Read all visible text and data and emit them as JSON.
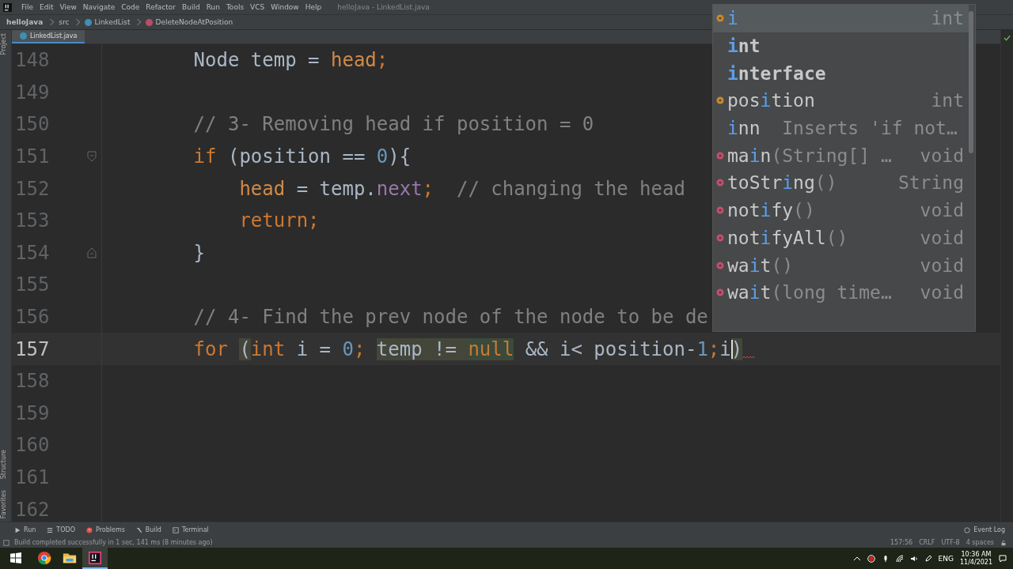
{
  "window": {
    "title": "helloJava - LinkedList.java"
  },
  "menu": [
    "File",
    "Edit",
    "View",
    "Navigate",
    "Code",
    "Refactor",
    "Build",
    "Run",
    "Tools",
    "VCS",
    "Window",
    "Help"
  ],
  "breadcrumbs": [
    {
      "label": "helloJava",
      "kind": "project"
    },
    {
      "label": "src",
      "kind": "folder"
    },
    {
      "label": "LinkedList",
      "kind": "class"
    },
    {
      "label": "DeleteNodeAtPosition",
      "kind": "method"
    }
  ],
  "left_tools": [
    {
      "label": "Project",
      "kind": "top"
    },
    {
      "label": "Structure",
      "kind": "bottom"
    },
    {
      "label": "Favorites",
      "kind": "bottom"
    }
  ],
  "tabs": [
    {
      "label": "LinkedList.java",
      "selected": true
    }
  ],
  "editor": {
    "lines": [
      {
        "number": "148",
        "current": false,
        "fold_start": false,
        "fold_end": false,
        "tokens": [
          {
            "text": "        Node temp = ",
            "kind": "plain",
            "marked": false
          },
          {
            "text": "head",
            "kind": "static",
            "marked": false
          },
          {
            "text": ";",
            "kind": "kw",
            "marked": false
          }
        ]
      },
      {
        "number": "149",
        "current": false,
        "fold_start": false,
        "fold_end": false
      },
      {
        "number": "150",
        "current": false,
        "fold_start": false,
        "fold_end": false,
        "tokens": [
          {
            "text": "        // 3- Removing head if position = 0",
            "kind": "comment",
            "marked": false
          }
        ]
      },
      {
        "number": "151",
        "current": false,
        "fold_start": true,
        "fold_end": false,
        "tokens": [
          {
            "text": "        if",
            "kind": "kw",
            "marked": false
          },
          {
            "text": " (position == ",
            "kind": "plain",
            "marked": false
          },
          {
            "text": "0",
            "kind": "num",
            "marked": false
          },
          {
            "text": "){",
            "kind": "plain",
            "marked": false
          }
        ]
      },
      {
        "number": "152",
        "current": false,
        "fold_start": false,
        "fold_end": false,
        "tokens": [
          {
            "text": "            head",
            "kind": "static",
            "marked": false
          },
          {
            "text": " = temp.",
            "kind": "plain",
            "marked": false
          },
          {
            "text": "next",
            "kind": "field",
            "marked": false
          },
          {
            "text": ";",
            "kind": "kw",
            "marked": false
          },
          {
            "text": "  // changing the head",
            "kind": "comment",
            "marked": false
          }
        ]
      },
      {
        "number": "153",
        "current": false,
        "fold_start": false,
        "fold_end": false,
        "tokens": [
          {
            "text": "            return;",
            "kind": "kw",
            "marked": false
          }
        ]
      },
      {
        "number": "154",
        "current": false,
        "fold_start": false,
        "fold_end": true,
        "tokens": [
          {
            "text": "        }",
            "kind": "plain",
            "marked": false
          }
        ]
      },
      {
        "number": "155",
        "current": false,
        "fold_start": false,
        "fold_end": false
      },
      {
        "number": "156",
        "current": false,
        "fold_start": false,
        "fold_end": false,
        "tokens": [
          {
            "text": "        // 4- Find the prev node of the node to be de",
            "kind": "comment",
            "marked": false
          }
        ]
      },
      {
        "number": "157",
        "current": true,
        "fold_start": false,
        "fold_end": false,
        "tokens": [
          {
            "text": "        for ",
            "kind": "kw",
            "marked": false
          },
          {
            "text": "(",
            "kind": "plain",
            "marked": true
          },
          {
            "text": "int",
            "kind": "kw",
            "marked": false
          },
          {
            "text": " i = ",
            "kind": "plain",
            "marked": false
          },
          {
            "text": "0",
            "kind": "num",
            "marked": false
          },
          {
            "text": "; ",
            "kind": "kw",
            "marked": false
          },
          {
            "text": "temp != ",
            "kind": "plain",
            "marked": true
          },
          {
            "text": "null",
            "kind": "kw",
            "marked": true
          },
          {
            "text": " && i< position-",
            "kind": "plain",
            "marked": false
          },
          {
            "text": "1",
            "kind": "num",
            "marked": false
          },
          {
            "text": ";",
            "kind": "kw",
            "marked": false
          },
          {
            "text": "i",
            "kind": "plain",
            "marked": false
          },
          {
            "text": ")",
            "kind": "plain",
            "marked": true
          }
        ]
      },
      {
        "number": "158",
        "current": false,
        "fold_start": false,
        "fold_end": false
      },
      {
        "number": "159",
        "current": false,
        "fold_start": false,
        "fold_end": false
      },
      {
        "number": "160",
        "current": false,
        "fold_start": false,
        "fold_end": false
      },
      {
        "number": "161",
        "current": false,
        "fold_start": false,
        "fold_end": false
      },
      {
        "number": "162",
        "current": false,
        "fold_start": false,
        "fold_end": false
      }
    ]
  },
  "completion": {
    "items": [
      {
        "kind": "field",
        "name": [
          {
            "text": "i",
            "match": true
          }
        ],
        "type": "int",
        "selected": true
      },
      {
        "kind": "keyword",
        "name": [
          {
            "text": "i",
            "match": true
          },
          {
            "text": "nt",
            "match": false
          }
        ],
        "selected": false
      },
      {
        "kind": "keyword",
        "name": [
          {
            "text": "i",
            "match": true
          },
          {
            "text": "nterface",
            "match": false
          }
        ],
        "selected": false
      },
      {
        "kind": "field",
        "name": [
          {
            "text": "pos",
            "match": false
          },
          {
            "text": "i",
            "match": true
          },
          {
            "text": "tion",
            "match": false
          }
        ],
        "type": "int",
        "selected": false
      },
      {
        "kind": "template",
        "name": [
          {
            "text": "i",
            "match": true
          },
          {
            "text": "nn",
            "match": false
          }
        ],
        "hint": "Inserts 'if not…",
        "selected": false
      },
      {
        "kind": "method",
        "name": [
          {
            "text": "ma",
            "match": false
          },
          {
            "text": "i",
            "match": true
          },
          {
            "text": "n",
            "match": false
          }
        ],
        "params": "(String[] …",
        "type": "void",
        "selected": false
      },
      {
        "kind": "method",
        "name": [
          {
            "text": "toStr",
            "match": false
          },
          {
            "text": "i",
            "match": true
          },
          {
            "text": "ng",
            "match": false
          }
        ],
        "params": "()",
        "type": "String",
        "selected": false
      },
      {
        "kind": "method",
        "name": [
          {
            "text": "not",
            "match": false
          },
          {
            "text": "i",
            "match": true
          },
          {
            "text": "fy",
            "match": false
          }
        ],
        "params": "()",
        "type": "void",
        "selected": false
      },
      {
        "kind": "method",
        "name": [
          {
            "text": "not",
            "match": false
          },
          {
            "text": "i",
            "match": true
          },
          {
            "text": "fyAll",
            "match": false
          }
        ],
        "params": "()",
        "type": "void",
        "selected": false
      },
      {
        "kind": "method",
        "name": [
          {
            "text": "wa",
            "match": false
          },
          {
            "text": "i",
            "match": true
          },
          {
            "text": "t",
            "match": false
          }
        ],
        "params": "()",
        "type": "void",
        "selected": false
      },
      {
        "kind": "method",
        "name": [
          {
            "text": "wa",
            "match": false
          },
          {
            "text": "i",
            "match": true
          },
          {
            "text": "t",
            "match": false
          }
        ],
        "params": "(long time…",
        "type": "void",
        "selected": false
      }
    ]
  },
  "tool_windows": [
    {
      "label": "Run",
      "kind": "run"
    },
    {
      "label": "TODO",
      "kind": "todo"
    },
    {
      "label": "Problems",
      "kind": "problems"
    },
    {
      "label": "Build",
      "kind": "build"
    },
    {
      "label": "Terminal",
      "kind": "terminal"
    }
  ],
  "event_log": "Event Log",
  "status_bar": {
    "message": "Build completed successfully in 1 sec, 141 ms (8 minutes ago)",
    "items": [
      "157:56",
      "CRLF",
      "UTF-8",
      "4 spaces"
    ]
  },
  "taskbar": {
    "apps": [
      {
        "kind": "chrome",
        "selected": false
      },
      {
        "kind": "explorer",
        "selected": false
      },
      {
        "kind": "intellij",
        "selected": true
      }
    ],
    "language": "ENG",
    "time": "10:36 AM",
    "date": "11/4/2021"
  }
}
